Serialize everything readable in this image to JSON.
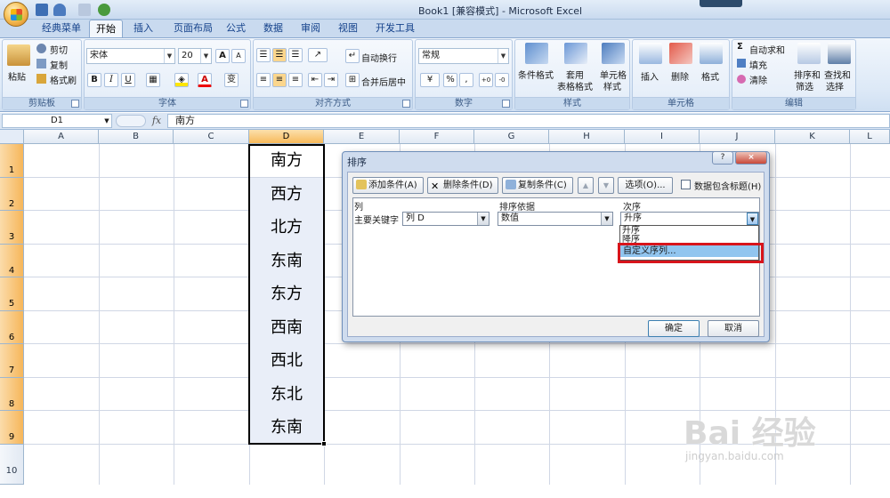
{
  "window": {
    "title": "Book1  [兼容模式] - Microsoft Excel"
  },
  "ribbon_tabs": [
    "经典菜单",
    "开始",
    "插入",
    "页面布局",
    "公式",
    "数据",
    "审阅",
    "视图",
    "开发工具"
  ],
  "active_tab": "开始",
  "ribbon": {
    "clipboard": {
      "paste": "粘贴",
      "cut": "剪切",
      "copy": "复制",
      "format_painter": "格式刷",
      "label": "剪贴板"
    },
    "font": {
      "font_name": "宋体",
      "font_size": "20",
      "bold": "B",
      "italic": "I",
      "underline": "U",
      "grow": "A",
      "shrink": "A",
      "wen": "变",
      "label": "字体"
    },
    "alignment": {
      "wrap": "自动换行",
      "merge": "合并后居中",
      "label": "对齐方式"
    },
    "number": {
      "format": "常规",
      "percent": "%",
      "comma": ",",
      "inc": ".0 .00",
      "dec": ".00 →.0",
      "label": "数字"
    },
    "styles": {
      "conditional": [
        "条件格式"
      ],
      "table": [
        "套用",
        "表格格式"
      ],
      "cell": [
        "单元格",
        "样式"
      ],
      "label": "样式"
    },
    "cells": {
      "insert": "插入",
      "delete": "删除",
      "format": "格式",
      "label": "单元格"
    },
    "editing": {
      "autosum": "自动求和",
      "fill": "填充",
      "clear": "清除",
      "sort": [
        "排序和",
        "筛选"
      ],
      "find": [
        "查找和",
        "选择"
      ],
      "label": "编辑"
    }
  },
  "formula_bar": {
    "name_box": "D1",
    "fx": "fx",
    "value": "南方"
  },
  "sheet": {
    "columns": [
      "A",
      "B",
      "C",
      "D",
      "E",
      "F",
      "G",
      "H",
      "I",
      "J",
      "K",
      "L"
    ],
    "selected_column": "D",
    "rows": [
      "1",
      "2",
      "3",
      "4",
      "5",
      "6",
      "7",
      "8",
      "9",
      "10"
    ],
    "column_d_values": [
      "南方",
      "西方",
      "北方",
      "东南",
      "东方",
      "西南",
      "西北",
      "东北",
      "东南"
    ]
  },
  "dialog": {
    "title": "排序",
    "help": "?",
    "close": "×",
    "buttons": {
      "add": "添加条件(A)",
      "delete": "删除条件(D)",
      "copy": "复制条件(C)",
      "up": "▲",
      "down": "▼",
      "options": "选项(O)...",
      "header_checkbox": "数据包含标题(H)"
    },
    "headers": {
      "column": "列",
      "sort_on": "排序依据",
      "order": "次序"
    },
    "row": {
      "label": "主要关键字",
      "column": "列 D",
      "sort_on": "数值",
      "order": "升序"
    },
    "order_options": [
      "升序",
      "降序",
      "自定义序列..."
    ],
    "highlighted_option": "自定义序列...",
    "ok": "确定",
    "cancel": "取消"
  },
  "watermark": {
    "main": "Bai 经验",
    "sub": "jingyan.baidu.com"
  },
  "colors": {
    "selection_header": "#f7b95a",
    "highlight_box": "#d8141b",
    "dropdown_highlight": "#91c5ef"
  }
}
